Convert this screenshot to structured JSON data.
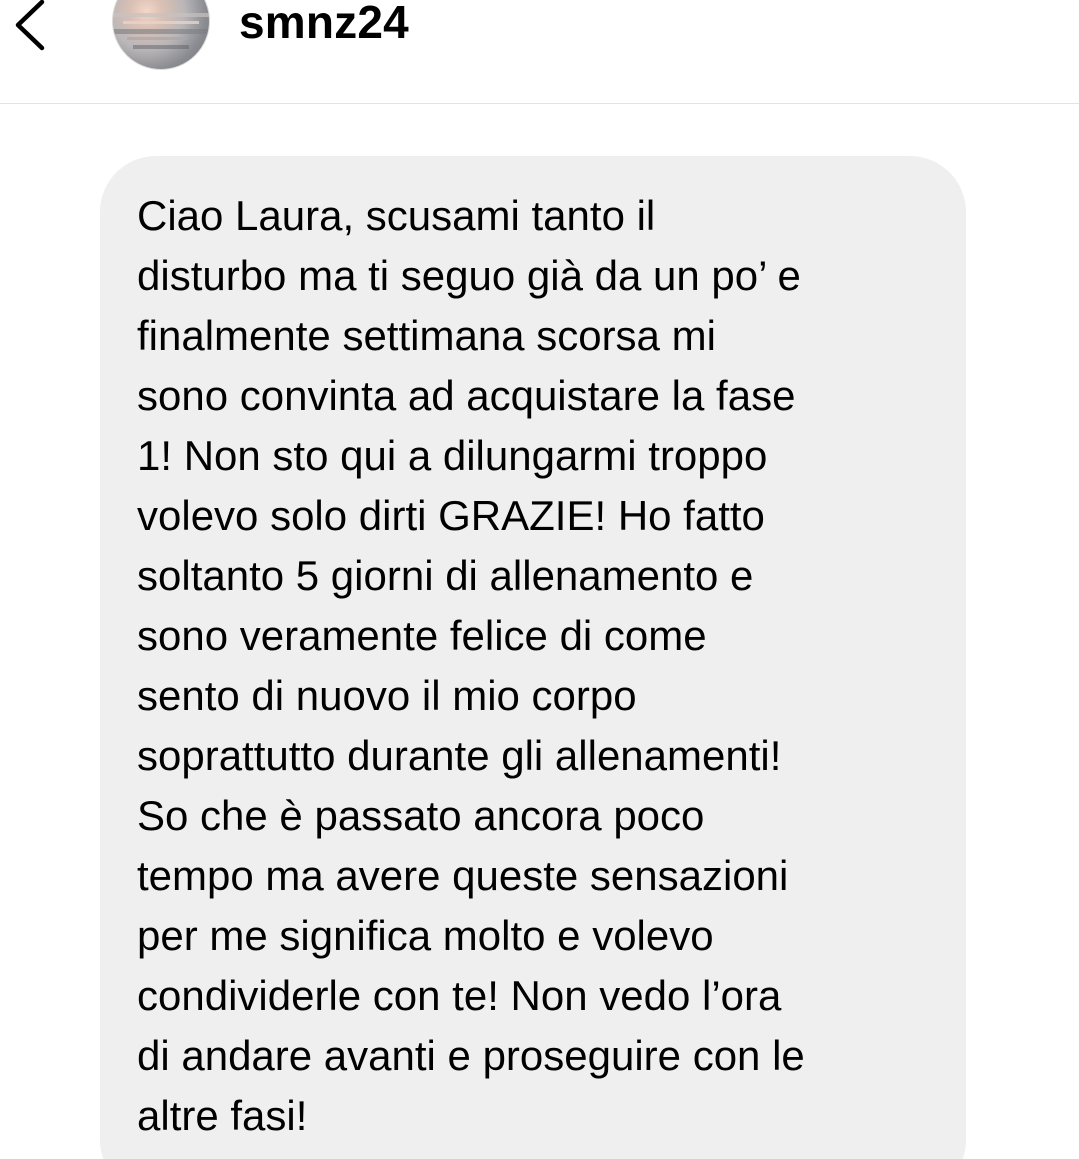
{
  "header": {
    "back_icon": "chevron-left-icon",
    "username": "smnz24"
  },
  "message": {
    "text": "Ciao Laura, scusami tanto il\ndisturbo ma ti seguo già da un po’ e\nfinalmente settimana scorsa mi\nsono convinta ad acquistare la fase\n1! Non sto qui a dilungarmi troppo\nvolevo solo dirti GRAZIE! Ho fatto\nsoltanto 5 giorni di allenamento e\nsono veramente felice di come\nsento di nuovo il mio corpo\nsoprattutto durante gli allenamenti!\nSo che è passato ancora poco\ntempo ma avere queste sensazioni\nper me significa molto e volevo\ncondividerle con te! Non vedo l’ora\ndi andare avanti e proseguire con le\naltre fasi!"
  },
  "colors": {
    "bubble_background": "#efefef",
    "text": "#000000",
    "divider": "#e3e3e3"
  }
}
